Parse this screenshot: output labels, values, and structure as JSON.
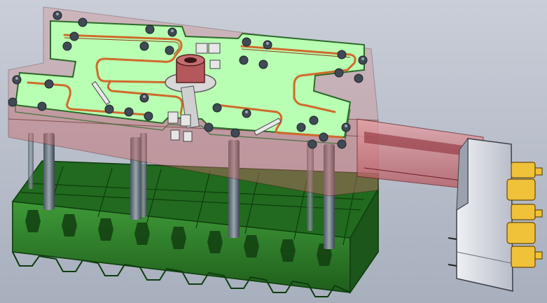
{
  "window": {
    "title": ""
  },
  "viewport": {
    "background_top": "#c9ced8",
    "background_bottom": "#a8afbd",
    "model": {
      "plate_fill": "#b9ffb3",
      "plate_edge": "#2c6a2a",
      "channel_color": "#d06a2b",
      "housing_fill": "#c86b6b",
      "housing_edge": "#5a1f1f",
      "rail_color": "#c0505a",
      "rack_fill": "#2d7d2a",
      "rack_edge": "#0e3d0e",
      "bolt_color": "#3f4a55",
      "gearbox_fill": "#d7dbe3",
      "actuator_color": "#f0c23a",
      "column_color": "#6e7b86",
      "hub_color": "#9c4b4b"
    }
  }
}
